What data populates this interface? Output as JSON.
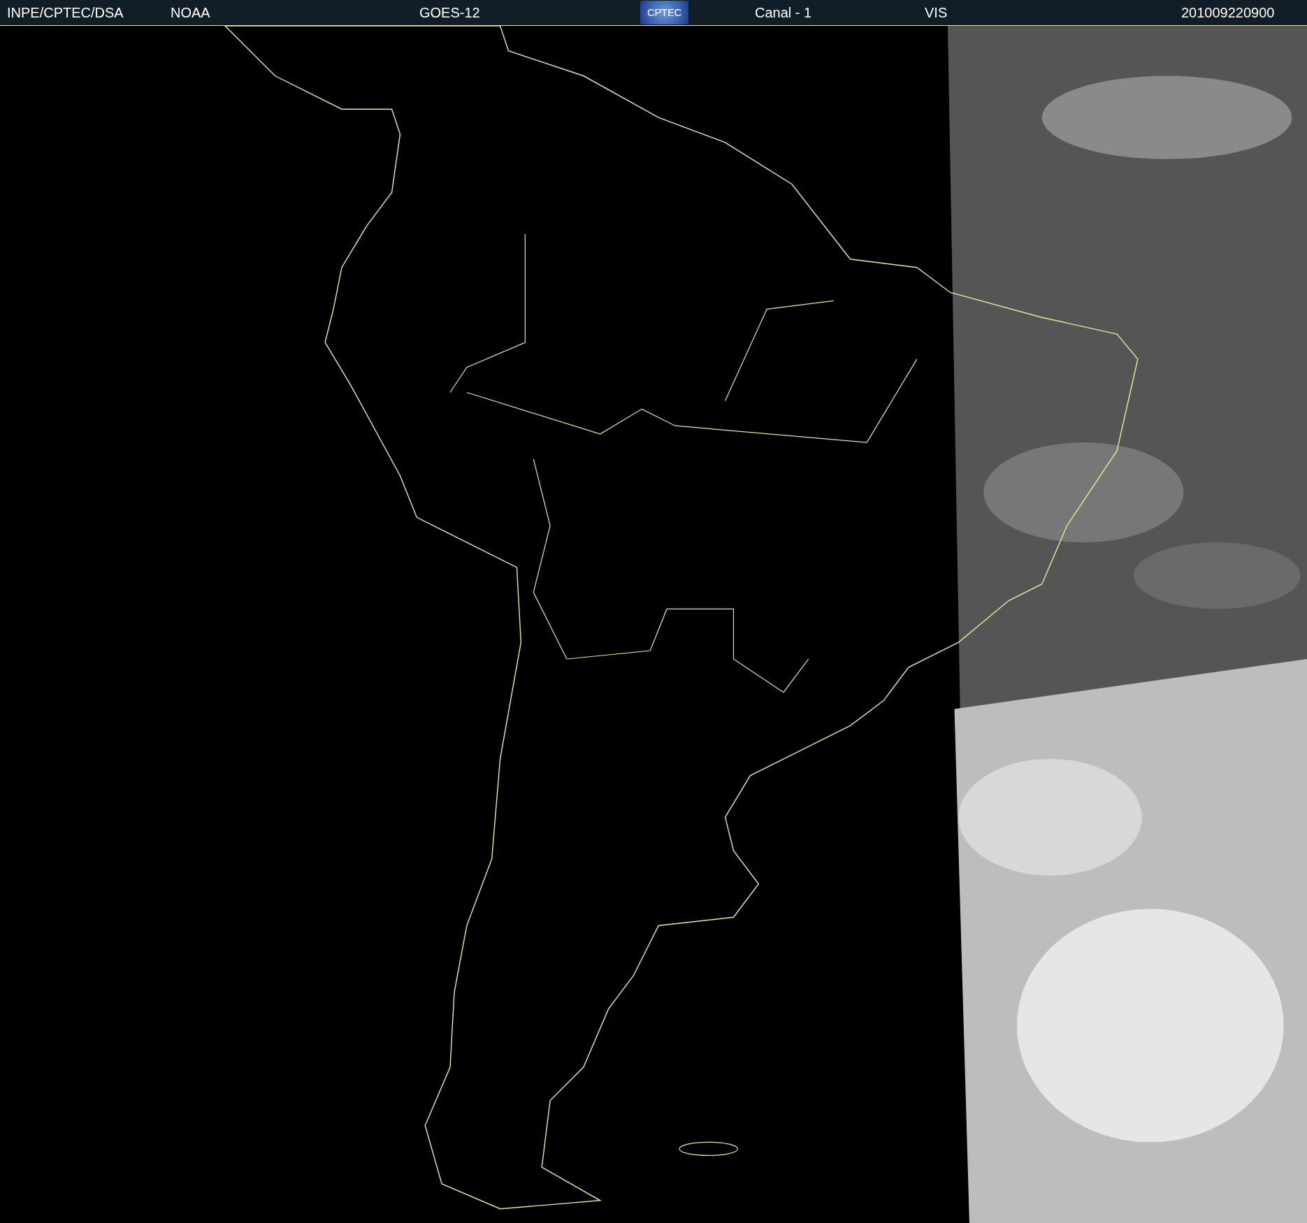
{
  "header": {
    "items": [
      {
        "kind": "text",
        "text": "INPE/CPTEC/DSA"
      },
      {
        "kind": "text",
        "text": "NOAA"
      },
      {
        "kind": "text",
        "text": "GOES-12"
      },
      {
        "kind": "logo",
        "text": "CPTEC"
      },
      {
        "kind": "text",
        "text": "Canal - 1"
      },
      {
        "kind": "text",
        "text": "VIS"
      },
      {
        "kind": "text",
        "text": "201009220900"
      }
    ]
  }
}
